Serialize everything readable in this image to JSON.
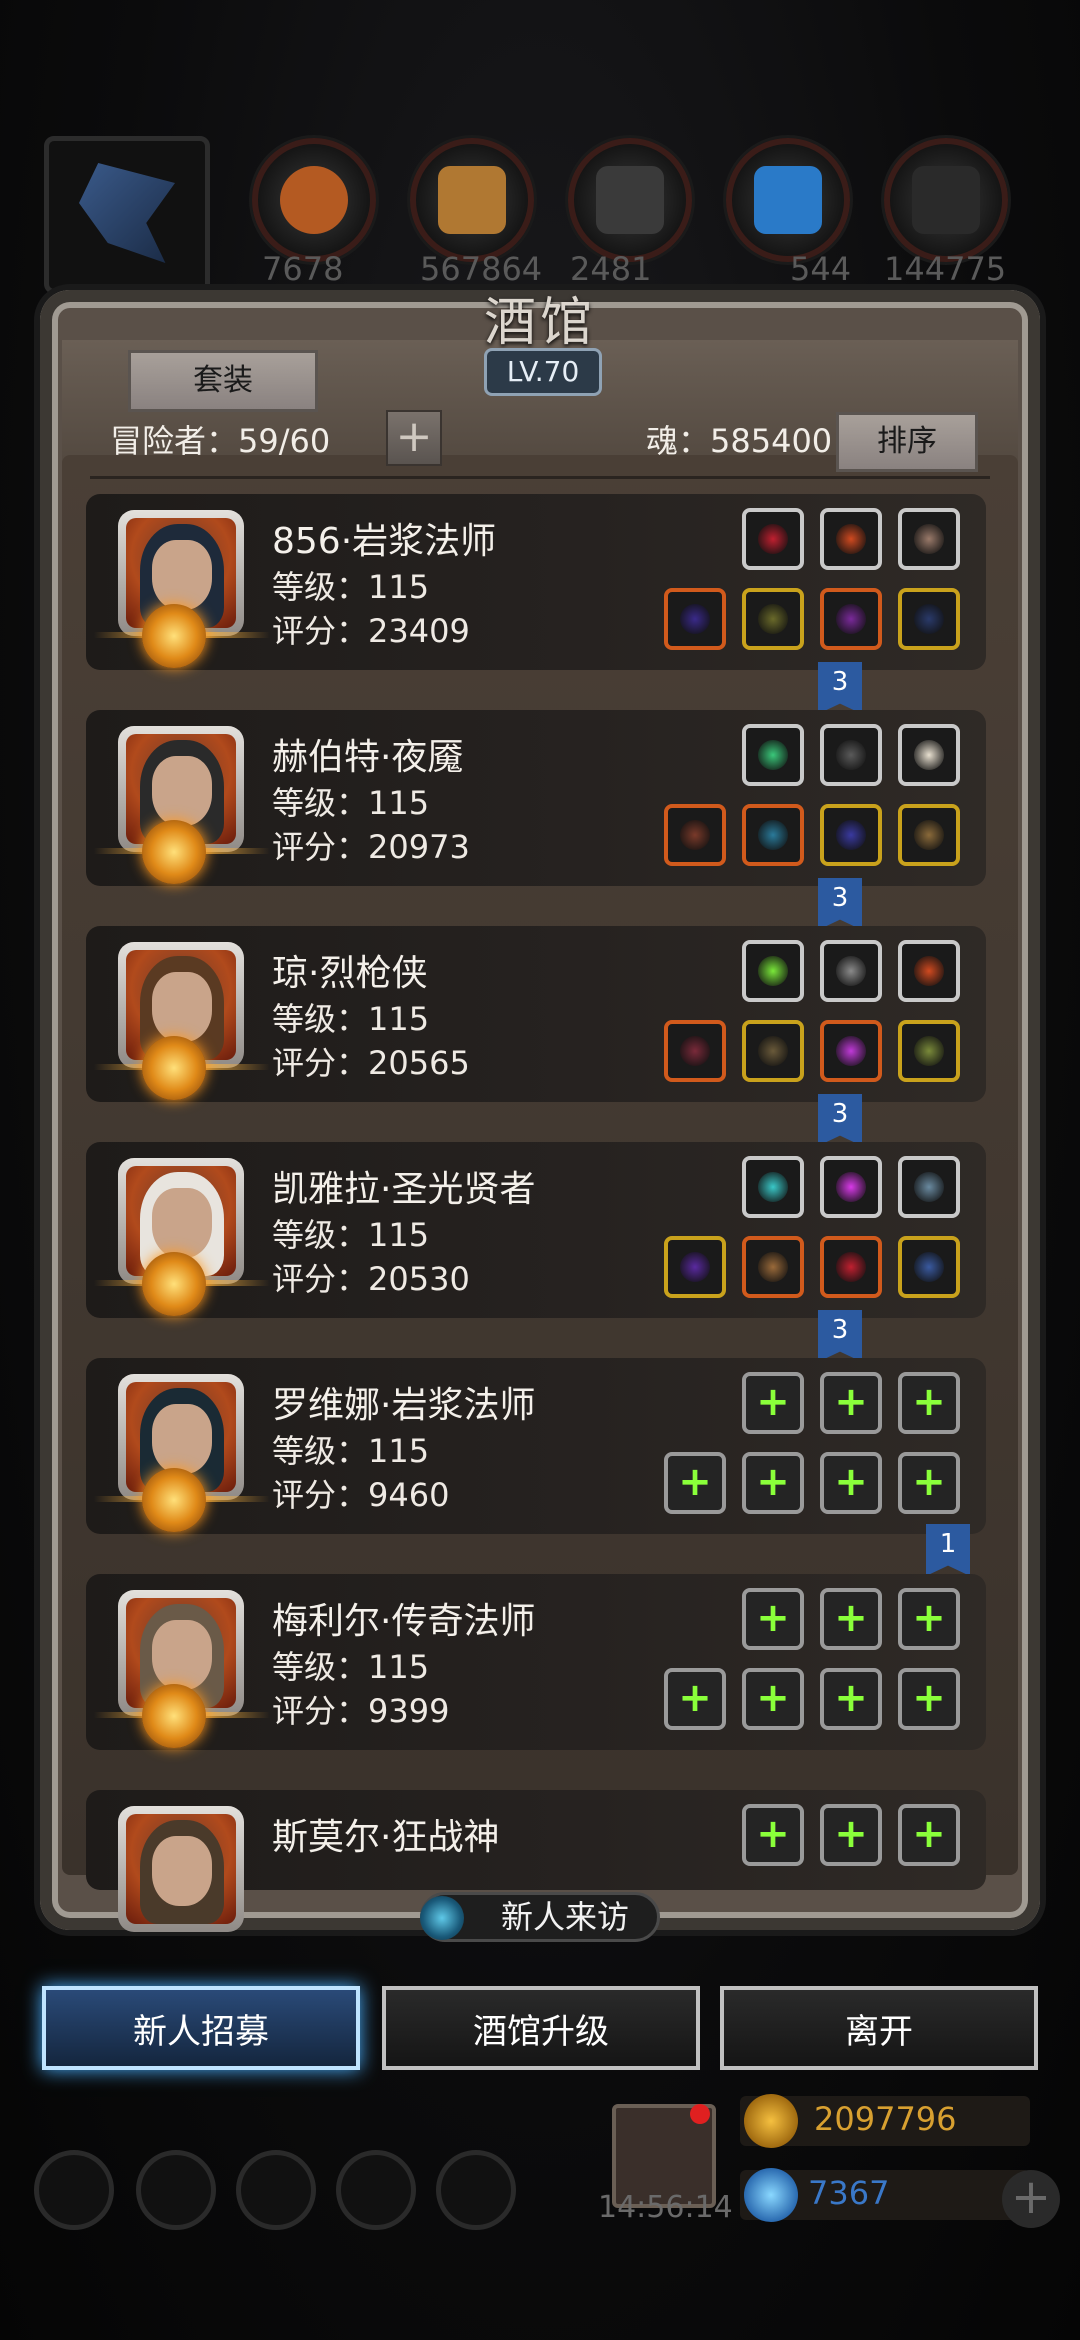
{
  "tavern": {
    "title": "酒馆",
    "level": "LV.70",
    "suit_button": "套装",
    "adventurer_label": "冒险者：59/60",
    "add_button": "+",
    "soul_label": "魂：585400",
    "sort_button": "排序"
  },
  "top_bar": {
    "numbers": [
      "7678",
      "567864",
      "2481",
      "544",
      "144775"
    ]
  },
  "heroes": [
    {
      "name": "856·岩浆法师",
      "level": "等级：115",
      "score": "评分：23409",
      "flag": "3",
      "empty": false
    },
    {
      "name": "赫伯特·夜魇",
      "level": "等级：115",
      "score": "评分：20973",
      "flag": "3",
      "empty": false
    },
    {
      "name": "琼·烈枪侠",
      "level": "等级：115",
      "score": "评分：20565",
      "flag": "3",
      "empty": false
    },
    {
      "name": "凯雅拉·圣光贤者",
      "level": "等级：115",
      "score": "评分：20530",
      "flag": "3",
      "empty": false
    },
    {
      "name": "罗维娜·岩浆法师",
      "level": "等级：115",
      "score": "评分：9460",
      "flag": "1",
      "empty": true
    },
    {
      "name": "梅利尔·传奇法师",
      "level": "等级：115",
      "score": "评分：9399",
      "flag": "",
      "empty": true
    },
    {
      "name": "斯莫尔·狂战神",
      "level": "",
      "score": "",
      "flag": "",
      "empty": true
    }
  ],
  "bottom": {
    "new_visit": "新人来访",
    "recruit": "新人招募",
    "upgrade": "酒馆升级",
    "leave": "离开",
    "timer": "14:56:14",
    "gold": "2097796",
    "diamond": "7367",
    "plus": "+"
  },
  "colors": {
    "accent_blue": "#4ab0ff",
    "plus_green": "#8aff3a",
    "orange_frame": "#d15a1c",
    "gold_frame": "#c9a21c",
    "gold_text": "#d8a030",
    "diamond_text": "#3a78c8"
  }
}
